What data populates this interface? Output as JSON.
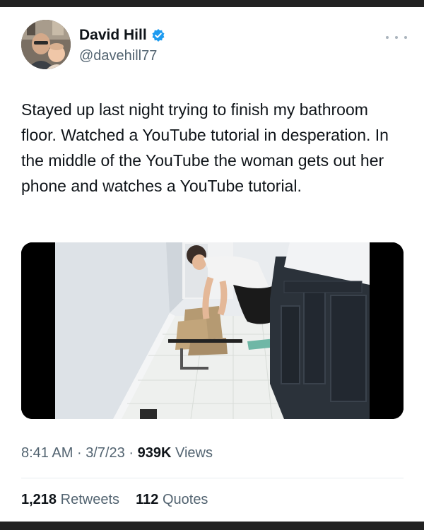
{
  "author": {
    "display_name": "David Hill",
    "handle": "@davehill77",
    "verified": true,
    "avatar_icon": "profile-photo",
    "more_icon": "more-horizontal-icon"
  },
  "tweet": {
    "text": "Stayed up last night trying to finish my bathroom floor. Watched a YouTube tutorial in desperation. In the middle of the YouTube the woman gets out her phone and watches a YouTube tutorial.",
    "media": {
      "kind": "video-still",
      "description_icon": "video-thumbnail"
    }
  },
  "meta": {
    "time": "8:41 AM",
    "separator": "·",
    "date": "3/7/23",
    "views_count": "939K",
    "views_label": "Views"
  },
  "stats": {
    "retweets_count": "1,218",
    "retweets_label": "Retweets",
    "quotes_count": "112",
    "quotes_label": "Quotes"
  },
  "colors": {
    "text_primary": "#0f1419",
    "text_secondary": "#536471",
    "verified_blue": "#1d9bf0",
    "divider": "#e6ecf0"
  }
}
